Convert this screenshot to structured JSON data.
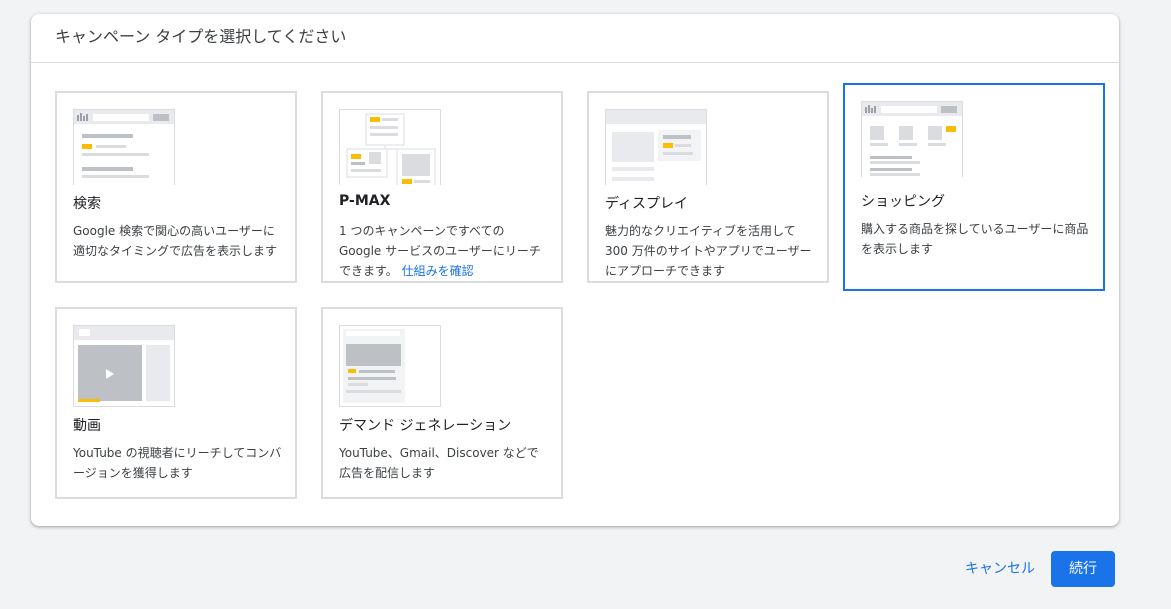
{
  "dialog": {
    "title": "キャンペーン タイプを選択してください"
  },
  "cards": [
    {
      "name": "検索",
      "description": "Google 検索で関心の高いユーザーに適切なタイミングで広告を表示します",
      "icon": "search-thumbnail"
    },
    {
      "name": "P-MAX",
      "description": "1 つのキャンペーンですべての Google サービスのユーザーにリーチできます。",
      "link": "仕組みを確認",
      "icon": "pmax-thumbnail"
    },
    {
      "name": "ディスプレイ",
      "description": "魅力的なクリエイティブを活用して 300 万件のサイトやアプリでユーザーにアプローチできます",
      "icon": "display-thumbnail"
    },
    {
      "name": "ショッピング",
      "description": "購入する商品を探しているユーザーに商品を表示します",
      "icon": "shopping-thumbnail",
      "selected": true
    },
    {
      "name": "動画",
      "description": "YouTube の視聴者にリーチしてコンバージョンを獲得します",
      "icon": "video-thumbnail"
    },
    {
      "name": "デマンド ジェネレーション",
      "description": "YouTube、Gmail、Discover などで広告を配信します",
      "icon": "demand-gen-thumbnail"
    }
  ],
  "actions": {
    "cancel": "キャンセル",
    "continue": "続行"
  },
  "colors": {
    "accent": "#1a73e8",
    "highlight": "#fbbc04",
    "card_border": "#dadce0"
  }
}
